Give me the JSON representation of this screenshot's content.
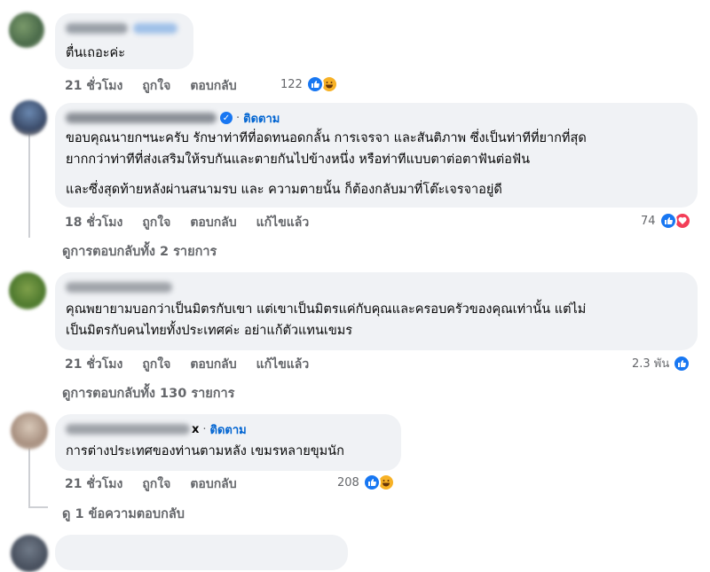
{
  "comments": [
    {
      "text": "ตื่นเถอะค่ะ",
      "time": "21 ชั่วโมง",
      "like_label": "ถูกใจ",
      "reply_label": "ตอบกลับ",
      "reaction_count": "122",
      "reactions": [
        "like",
        "haha"
      ]
    },
    {
      "follow_label": "ติดตาม",
      "verified": true,
      "lines": [
        "ขอบคุณนายกฯนะครับ รักษาท่าทีที่อดทนอดกลั้น การเจรจา และสันติภาพ ซึ่งเป็นท่าทีที่ยากที่สุด",
        "ยากกว่าท่าทีที่ส่งเสริมให้รบกันและตายกันไปข้างหนึ่ง หรือท่าทีแบบตาต่อตาฟันต่อฟัน",
        "และซึ่งสุดท้ายหลังผ่านสนามรบ และ ความตายนั้น ก็ต้องกลับมาที่โต๊ะเจรจาอยู่ดี"
      ],
      "time": "18 ชั่วโมง",
      "like_label": "ถูกใจ",
      "reply_label": "ตอบกลับ",
      "edited_label": "แก้ไขแล้ว",
      "reaction_count": "74",
      "reactions": [
        "like",
        "love"
      ],
      "view_replies": "ดูการตอบกลับทั้ง 2 รายการ"
    },
    {
      "lines": [
        "คุณพยายามบอกว่าเป็นมิตรกับเขา แต่เขาเป็นมิตรแค่กับคุณและครอบครัวของคุณเท่านั้น แต่ไม่",
        "เป็นมิตรกับคนไทยทั้งประเทศค่ะ อย่าแก้ตัวแทนเขมร"
      ],
      "time": "21 ชั่วโมง",
      "like_label": "ถูกใจ",
      "reply_label": "ตอบกลับ",
      "edited_label": "แก้ไขแล้ว",
      "reaction_count": "2.3 พัน",
      "reactions": [
        "like"
      ],
      "view_replies": "ดูการตอบกลับทั้ง 130 รายการ"
    },
    {
      "name_suffix": "x",
      "follow_label": "ติดตาม",
      "text": "การต่างประเทศของท่านตามหลัง เขมรหลายขุมนัก",
      "time": "21 ชั่วโมง",
      "like_label": "ถูกใจ",
      "reply_label": "ตอบกลับ",
      "reaction_count": "208",
      "reactions": [
        "like",
        "haha"
      ],
      "view_replies": "ดู 1 ข้อความตอบกลับ"
    }
  ],
  "colors": {
    "bubble": "#f0f2f5",
    "link": "#0064d1",
    "secondary": "#65676b",
    "like": "#1877f2",
    "love": "#f33e58",
    "haha": "#f7b125"
  }
}
